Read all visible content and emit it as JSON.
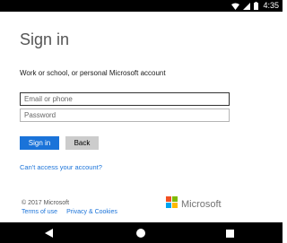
{
  "status_bar": {
    "time": "4:35",
    "icons": [
      "wifi-icon",
      "signal-icon",
      "battery-icon"
    ]
  },
  "page": {
    "title": "Sign in",
    "subtitle": "Work or school, or personal Microsoft account"
  },
  "form": {
    "email_placeholder": "Email or phone",
    "password_placeholder": "Password",
    "signin_label": "Sign in",
    "back_label": "Back"
  },
  "help": {
    "link": "Can't access your account?"
  },
  "footer": {
    "copyright": "© 2017 Microsoft",
    "terms": "Terms of use",
    "privacy": "Privacy & Cookies",
    "brand": "Microsoft"
  },
  "colors": {
    "accent": "#1a73d9",
    "logo_red": "#f25022",
    "logo_green": "#7fba00",
    "logo_blue": "#00a4ef",
    "logo_yellow": "#ffb900"
  },
  "nav_bar": {
    "icons": [
      "back-icon",
      "home-icon",
      "recent-apps-icon"
    ]
  }
}
